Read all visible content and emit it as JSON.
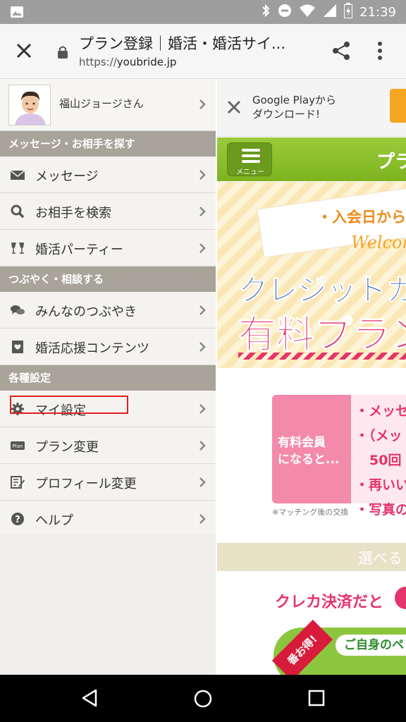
{
  "status": {
    "time": "21:39"
  },
  "browser": {
    "title": "プラン登録｜婚活・婚活サイ...",
    "url_scheme": "https://",
    "url_domain": "youbride.jp"
  },
  "drawer": {
    "profile_name": "福山ジョージさん",
    "sections": {
      "s1": "メッセージ・お相手を探す",
      "s2": "つぶやく・相談する",
      "s3": "各種設定"
    },
    "items": {
      "message": "メッセージ",
      "search": "お相手を検索",
      "party": "婚活パーティー",
      "tsubuyaki": "みんなのつぶやき",
      "support": "婚活応援コンテンツ",
      "my_settings": "マイ設定",
      "plan_change": "プラン変更",
      "profile_change": "プロフィール変更",
      "help": "ヘルプ"
    }
  },
  "web": {
    "google_play_line1": "Google Playから",
    "google_play_line2": "ダウンロード!",
    "menu_label": "メニュー",
    "header_title": "プラ",
    "banner_text": "・入会日から",
    "welcome": "Welcom",
    "credit_text": "クレジットカー",
    "paid_plan_text": "有料プラン",
    "paid_member_line1": "有料会員",
    "paid_member_line2": "になると...",
    "benefit_1": "・メッセ",
    "benefit_2": "・（メッ",
    "benefit_3": "50回",
    "benefit_4": "・再いい",
    "benefit_5": "・写真の",
    "note": "※マッチング後の交換",
    "choose": "選べる",
    "kureka": "クレカ決済だと",
    "ribbon": "番お得!",
    "pill": "ご自身のペ"
  },
  "colors": {
    "section_bg": "#a8a49a",
    "green": "#8cc63f",
    "pink": "#e5336c",
    "highlight": "#e02020"
  }
}
